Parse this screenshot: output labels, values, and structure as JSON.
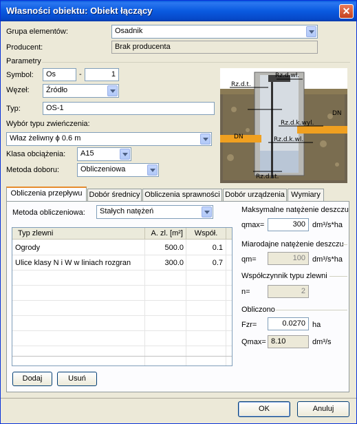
{
  "window": {
    "title": "Własności obiektu: Obiekt łączący",
    "close_glyph": "✕"
  },
  "form": {
    "grupa_label": "Grupa elementów:",
    "grupa_value": "Osadnik",
    "producent_label": "Producent:",
    "producent_value": "Brak producenta",
    "parametry_label": "Parametry",
    "symbol_label": "Symbol:",
    "symbol_value": "Os",
    "symbol_sep": "-",
    "symbol_number": "1",
    "wezel_label": "Węzeł:",
    "wezel_value": "Źródło",
    "typ_label": "Typ:",
    "typ_value": "OS-1",
    "zwienczenie_label": "Wybór typu zwieńczenia:",
    "zwienczenie_value": "Właz żeliwny ϕ 0.6 m",
    "klasa_label": "Klasa obciążenia:",
    "klasa_value": "A15",
    "metoda_doboru_label": "Metoda doboru:",
    "metoda_doboru_value": "Obliczeniowa"
  },
  "diagram": {
    "labels": [
      "Rz.d.wł.",
      "Rz.d.t.",
      "DN",
      "DN",
      "Rz.d.k.wyl.",
      "Rz.d.k.wl.",
      "Rz.d.st."
    ]
  },
  "tabs": [
    "Obliczenia przepływu",
    "Dobór średnicy",
    "Obliczenia sprawności",
    "Dobór urządzenia",
    "Wymiary"
  ],
  "calc": {
    "metoda_label": "Metoda obliczeniowa:",
    "metoda_value": "Stałych natężeń",
    "table": {
      "headers": [
        "Typ zlewni",
        "A. zl. [m²]",
        "Współ."
      ],
      "rows": [
        [
          "Ogrody",
          "500.0",
          "0.1"
        ],
        [
          "Ulice klasy N i W w liniach rozgran",
          "300.0",
          "0.7"
        ]
      ]
    },
    "add_button": "Dodaj",
    "remove_button": "Usuń",
    "max_label": "Maksymalne natężenie deszczu",
    "qmax_label": "qmax=",
    "qmax_value": "300",
    "qmax_unit": "dm³/s*ha",
    "miarodajne_label": "Miarodajne natężenie deszczu",
    "qm_label": "qm=",
    "qm_value": "100",
    "qm_unit": "dm³/s*ha",
    "wsp_label": "Współczynnik typu zlewni",
    "n_label": "n=",
    "n_value": "2",
    "obliczono_label": "Obliczono",
    "fzr_label": "Fzr=",
    "fzr_value": "0.0270",
    "fzr_unit": "ha",
    "Qmax_label": "Qmax=",
    "Qmax_value": "8.10",
    "Qmax_unit": "dm³/s"
  },
  "footer": {
    "ok": "OK",
    "cancel": "Anuluj"
  }
}
